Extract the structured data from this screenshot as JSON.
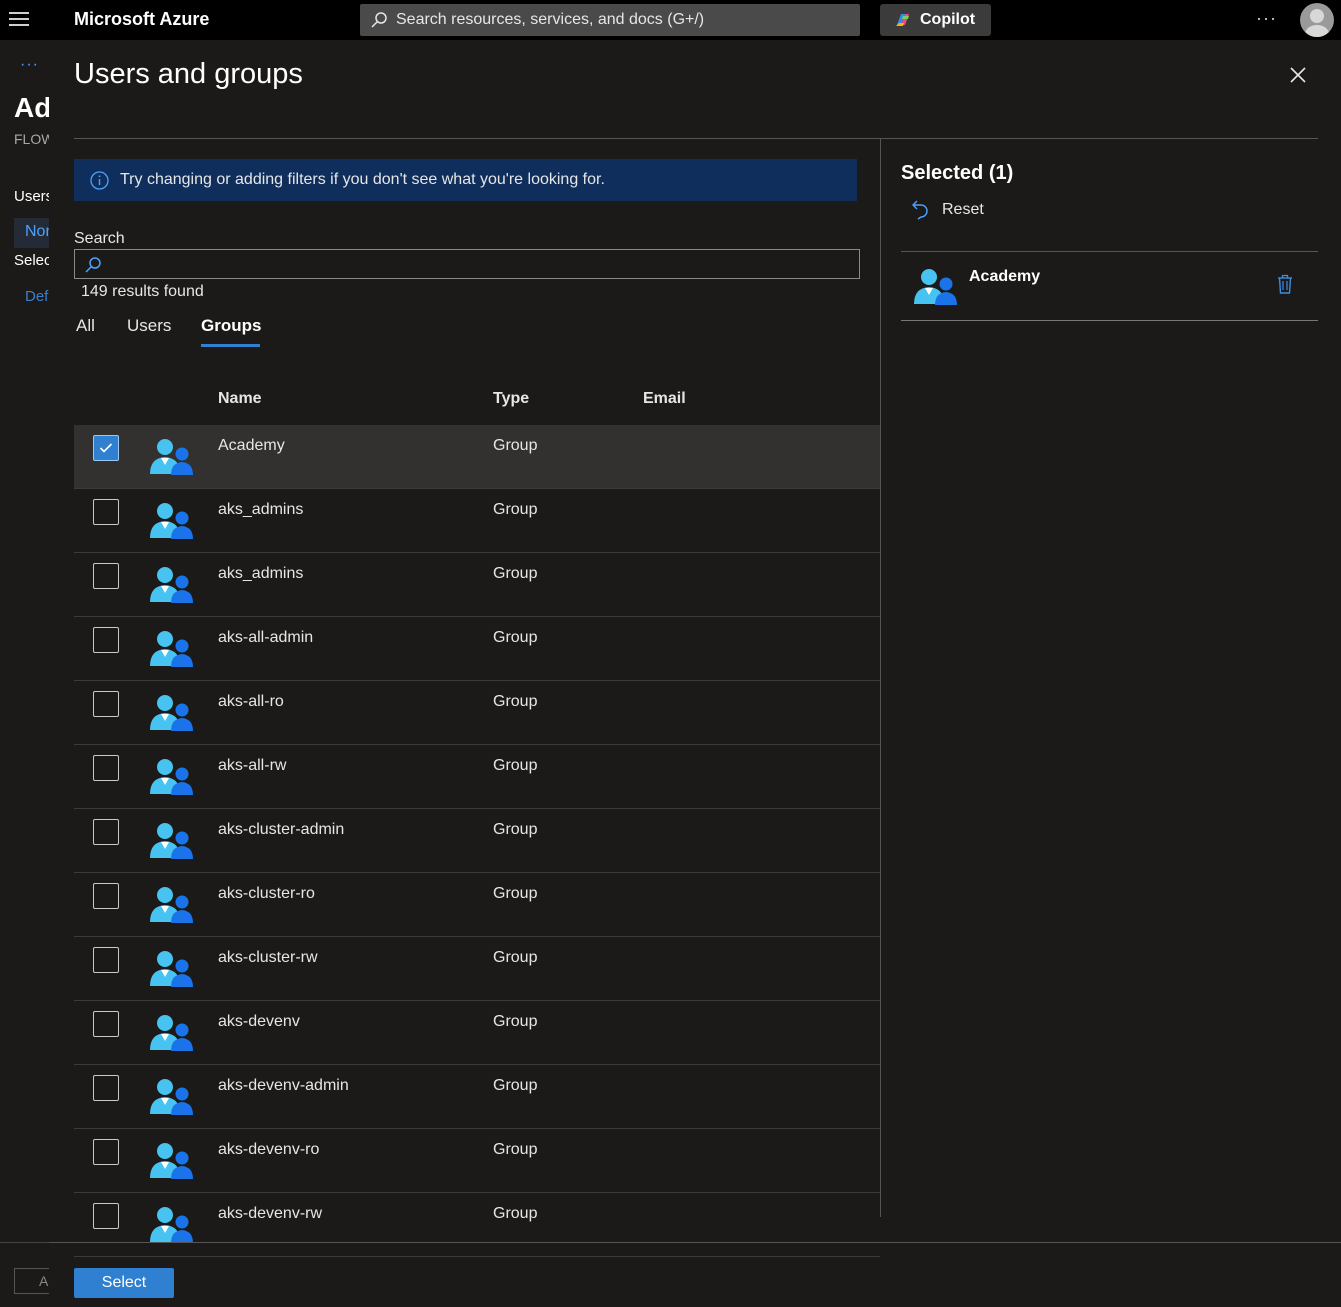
{
  "topbar": {
    "brand": "Microsoft Azure",
    "search_placeholder": "Search resources, services, and docs (G+/)",
    "copilot_label": "Copilot",
    "more": "···"
  },
  "background_blade": {
    "ellipsis": "···",
    "title": "Ad",
    "subtitle": "FLOW",
    "users_label": "Users",
    "none_label": "Non",
    "select_label": "Selec",
    "default_label": "Def",
    "button_label": "A"
  },
  "panel": {
    "title": "Users and groups",
    "info_message": "Try changing or adding filters if you don't see what you're looking for.",
    "search_label": "Search",
    "search_value": "",
    "results_text": "149 results found",
    "tabs": [
      {
        "label": "All",
        "active": false
      },
      {
        "label": "Users",
        "active": false
      },
      {
        "label": "Groups",
        "active": true
      }
    ],
    "columns": {
      "name": "Name",
      "type": "Type",
      "email": "Email"
    },
    "rows": [
      {
        "name": "Academy",
        "type": "Group",
        "email": "",
        "selected": true
      },
      {
        "name": "aks_admins",
        "type": "Group",
        "email": "",
        "selected": false
      },
      {
        "name": "aks_admins",
        "type": "Group",
        "email": "",
        "selected": false
      },
      {
        "name": "aks-all-admin",
        "type": "Group",
        "email": "",
        "selected": false
      },
      {
        "name": "aks-all-ro",
        "type": "Group",
        "email": "",
        "selected": false
      },
      {
        "name": "aks-all-rw",
        "type": "Group",
        "email": "",
        "selected": false
      },
      {
        "name": "aks-cluster-admin",
        "type": "Group",
        "email": "",
        "selected": false
      },
      {
        "name": "aks-cluster-ro",
        "type": "Group",
        "email": "",
        "selected": false
      },
      {
        "name": "aks-cluster-rw",
        "type": "Group",
        "email": "",
        "selected": false
      },
      {
        "name": "aks-devenv",
        "type": "Group",
        "email": "",
        "selected": false
      },
      {
        "name": "aks-devenv-admin",
        "type": "Group",
        "email": "",
        "selected": false
      },
      {
        "name": "aks-devenv-ro",
        "type": "Group",
        "email": "",
        "selected": false
      },
      {
        "name": "aks-devenv-rw",
        "type": "Group",
        "email": "",
        "selected": false
      }
    ],
    "selected_pane": {
      "title": "Selected (1)",
      "reset_label": "Reset",
      "items": [
        {
          "name": "Academy",
          "icon": "group-icon"
        }
      ]
    },
    "select_button": "Select"
  },
  "colors": {
    "accent": "#2f80d0",
    "banner_bg": "#0f2e5c",
    "background": "#1b1a19",
    "topbar": "#000000"
  }
}
